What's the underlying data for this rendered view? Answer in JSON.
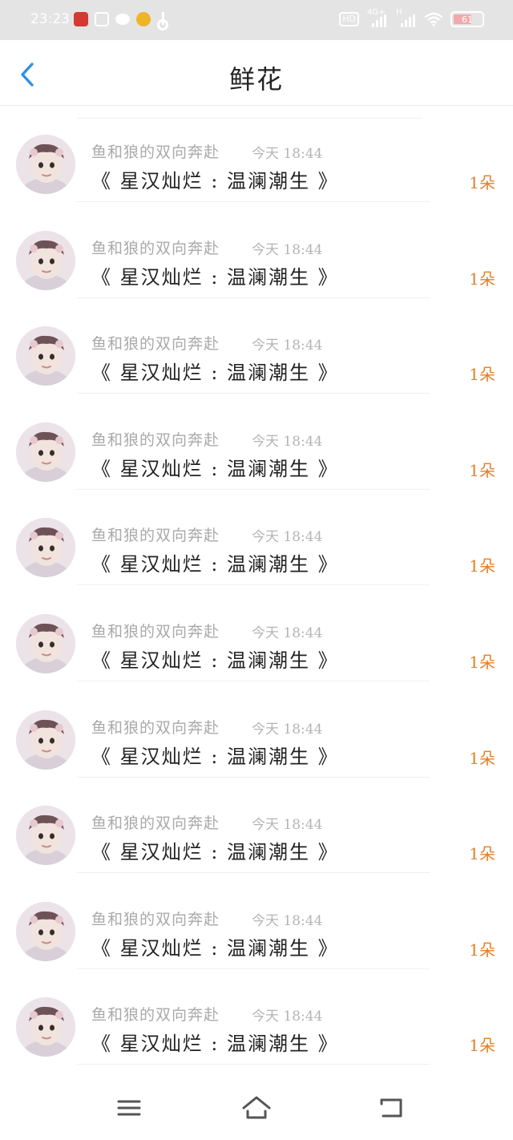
{
  "status_bar": {
    "time": "23:23",
    "hd_label": "HD",
    "network_1": "4G+",
    "network_2": "H",
    "battery": "61",
    "icons": [
      "netease-music-icon",
      "app-box-icon",
      "wechat-icon",
      "weibo-icon",
      "tiktok-icon"
    ]
  },
  "header": {
    "title": "鲜花",
    "back_icon": "chevron-left-icon",
    "accent_color": "#2f8fe6"
  },
  "list": [
    {
      "sender": "鱼和狼的双向奔赴",
      "time": "今天 18:44",
      "book": "《 星汉灿烂 : 温澜潮生 》",
      "count": "1朵"
    },
    {
      "sender": "鱼和狼的双向奔赴",
      "time": "今天 18:44",
      "book": "《 星汉灿烂 : 温澜潮生 》",
      "count": "1朵"
    },
    {
      "sender": "鱼和狼的双向奔赴",
      "time": "今天 18:44",
      "book": "《 星汉灿烂 : 温澜潮生 》",
      "count": "1朵"
    },
    {
      "sender": "鱼和狼的双向奔赴",
      "time": "今天 18:44",
      "book": "《 星汉灿烂 : 温澜潮生 》",
      "count": "1朵"
    },
    {
      "sender": "鱼和狼的双向奔赴",
      "time": "今天 18:44",
      "book": "《 星汉灿烂 : 温澜潮生 》",
      "count": "1朵"
    },
    {
      "sender": "鱼和狼的双向奔赴",
      "time": "今天 18:44",
      "book": "《 星汉灿烂 : 温澜潮生 》",
      "count": "1朵"
    },
    {
      "sender": "鱼和狼的双向奔赴",
      "time": "今天 18:44",
      "book": "《 星汉灿烂 : 温澜潮生 》",
      "count": "1朵"
    },
    {
      "sender": "鱼和狼的双向奔赴",
      "time": "今天 18:44",
      "book": "《 星汉灿烂 : 温澜潮生 》",
      "count": "1朵"
    },
    {
      "sender": "鱼和狼的双向奔赴",
      "time": "今天 18:44",
      "book": "《 星汉灿烂 : 温澜潮生 》",
      "count": "1朵"
    },
    {
      "sender": "鱼和狼的双向奔赴",
      "time": "今天 18:44",
      "book": "《 星汉灿烂 : 温澜潮生 》",
      "count": "1朵"
    }
  ],
  "colors": {
    "count": "#e07f2a",
    "sender": "#a9a9a9",
    "status_bar_bg": "#e4e4e4"
  },
  "nav": {
    "icons": [
      "menu-icon",
      "home-icon",
      "back-icon"
    ]
  }
}
